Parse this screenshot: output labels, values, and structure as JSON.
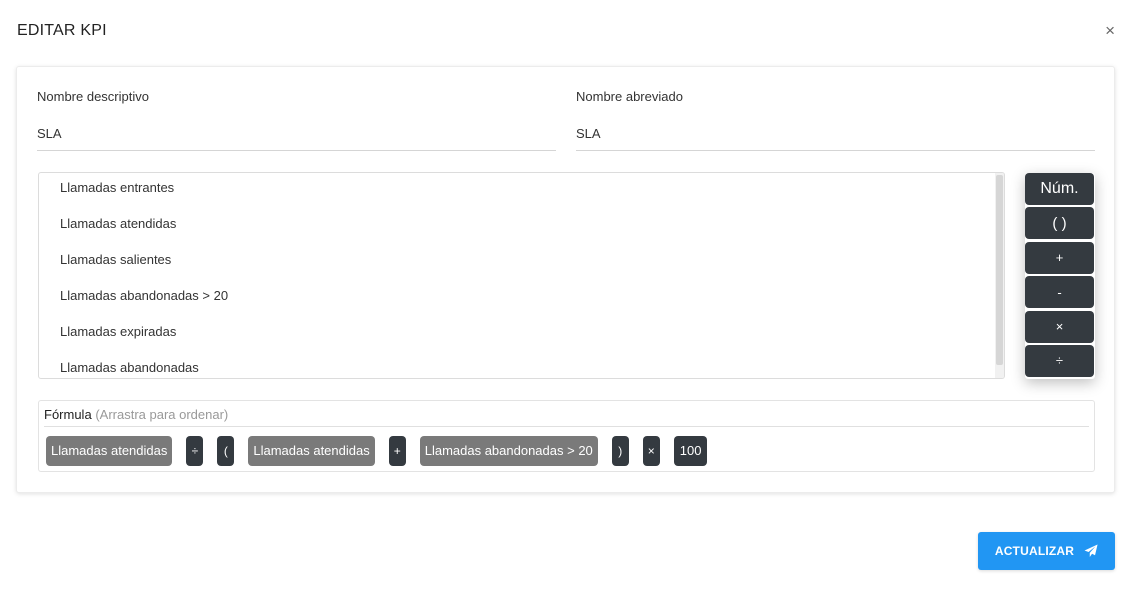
{
  "modal": {
    "title": "EDITAR KPI",
    "close_glyph": "×"
  },
  "form": {
    "descriptive_name": {
      "label": "Nombre descriptivo",
      "value": "SLA"
    },
    "short_name": {
      "label": "Nombre abreviado",
      "value": "SLA"
    }
  },
  "variables": [
    "Llamadas entrantes",
    "Llamadas atendidas",
    "Llamadas salientes",
    "Llamadas abandonadas > 20",
    "Llamadas expiradas",
    "Llamadas abandonadas"
  ],
  "operators": {
    "num": "Núm.",
    "parens": "( )",
    "plus": "+",
    "minus": "-",
    "times": "×",
    "divide": "÷"
  },
  "formula": {
    "label": "Fórmula",
    "hint": "(Arrastra para ordenar)",
    "tokens": [
      {
        "type": "var",
        "text": "Llamadas atendidas"
      },
      {
        "type": "op",
        "text": "÷"
      },
      {
        "type": "op",
        "text": "("
      },
      {
        "type": "var",
        "text": "Llamadas atendidas"
      },
      {
        "type": "op",
        "text": "+"
      },
      {
        "type": "var",
        "text": "Llamadas abandonadas > 20"
      },
      {
        "type": "op",
        "text": ")"
      },
      {
        "type": "op",
        "text": "×"
      },
      {
        "type": "num",
        "text": "100"
      }
    ]
  },
  "actions": {
    "update_label": "ACTUALIZAR",
    "update_icon": "paper-plane-icon"
  },
  "colors": {
    "primary": "#2196f3",
    "dark": "#343a40",
    "variable_token": "#7a7a7a"
  }
}
